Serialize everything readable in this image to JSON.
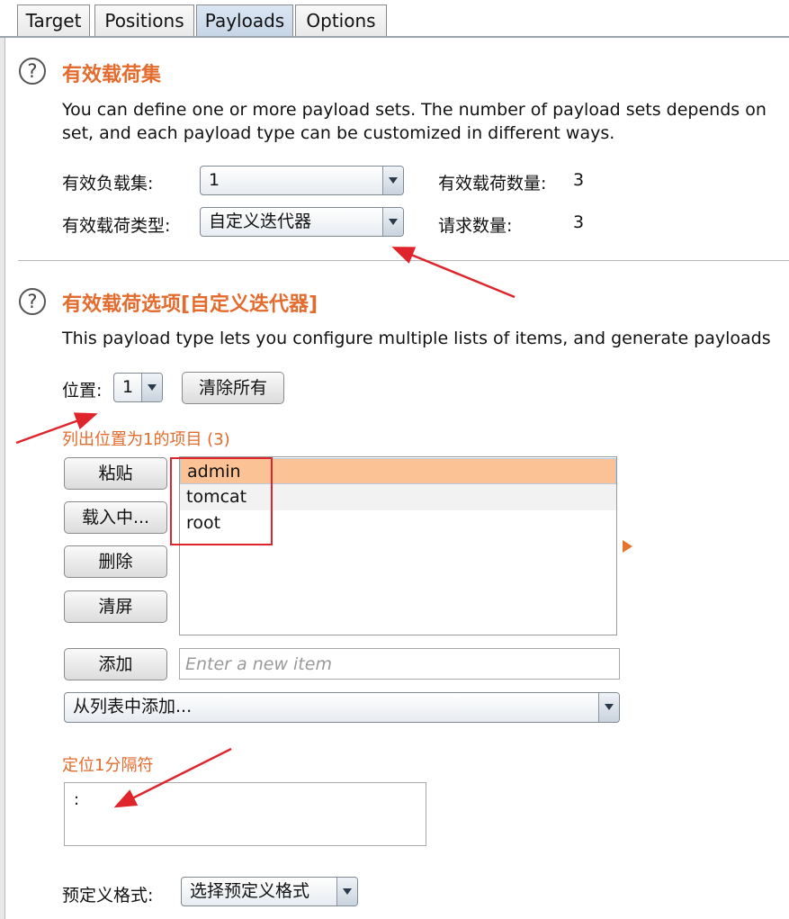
{
  "tabs": [
    {
      "label": "Target",
      "active": false
    },
    {
      "label": "Positions",
      "active": false
    },
    {
      "label": "Payloads",
      "active": true
    },
    {
      "label": "Options",
      "active": false
    }
  ],
  "payload_sets": {
    "help_icon": "question-circle-icon",
    "title": "有效载荷集",
    "description_line1": "You can define one or more payload sets. The number of payload sets depends on",
    "description_line2": "set, and each payload type can be customized in different ways.",
    "set_label": "有效负载集:",
    "set_value": "1",
    "type_label": "有效载荷类型:",
    "type_value": "自定义迭代器",
    "count_label": "有效载荷数量:",
    "count_value": "3",
    "requests_label": "请求数量:",
    "requests_value": "3"
  },
  "payload_options": {
    "help_icon": "question-circle-icon",
    "title": "有效载荷选项[自定义迭代器]",
    "description": "This payload type lets you configure multiple lists of items, and generate payloads",
    "position_label": "位置:",
    "position_value": "1",
    "clear_all_label": "清除所有",
    "list_caption": "列出位置为1的项目 (3)",
    "buttons": {
      "paste": "粘贴",
      "load": "载入中...",
      "remove": "删除",
      "clear": "清屏",
      "add": "添加"
    },
    "items": [
      "admin",
      "tomcat",
      "root"
    ],
    "new_item_placeholder": "Enter a new item",
    "add_from_list": "从列表中添加...",
    "separator_caption": "定位1分隔符",
    "separator_value": ":",
    "predefined_label": "预定义格式:",
    "predefined_value": "选择预定义格式"
  },
  "colors": {
    "accent": "#e36b2d",
    "selected_row": "#fbc395",
    "annotation": "#e0242b"
  }
}
